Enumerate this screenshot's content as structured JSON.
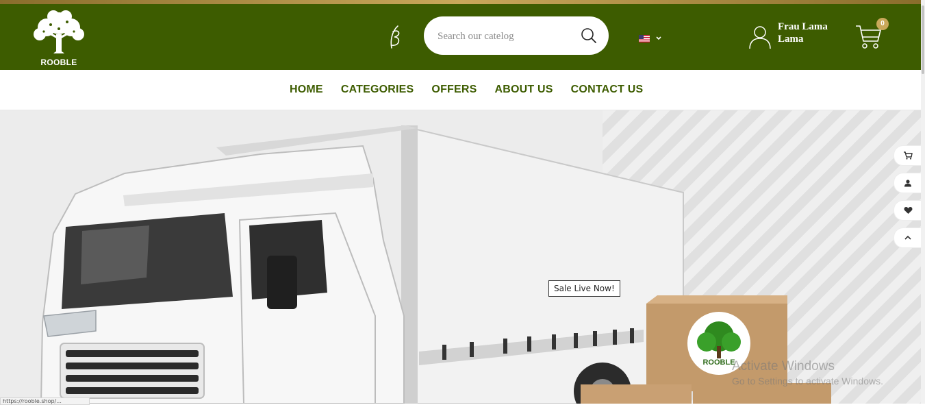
{
  "header": {
    "logo_text": "ROOBLE",
    "search_placeholder": "Search our catelog",
    "language_flag": "us-flag-icon",
    "user_name": "Frau Lama Lama",
    "cart_count": "0"
  },
  "nav": {
    "items": [
      "HOME",
      "CATEGORIES",
      "OFFERS",
      "ABOUT US",
      "CONTACT US"
    ]
  },
  "hero": {
    "sale_tag": "Sale Live Now!",
    "box_logo_text": "ROOBLE"
  },
  "floating_actions": [
    "cart-icon",
    "user-icon",
    "heart-icon",
    "chevron-up-icon"
  ],
  "watermark": {
    "title": "Activate Windows",
    "subtitle": "Go to Settings to activate Windows."
  },
  "status_bar": {
    "url": "https://rooble.shop/..."
  },
  "colors": {
    "header_green": "#3d5c00",
    "accent_gold": "#c9a85a",
    "nav_text": "#3d5c00"
  }
}
